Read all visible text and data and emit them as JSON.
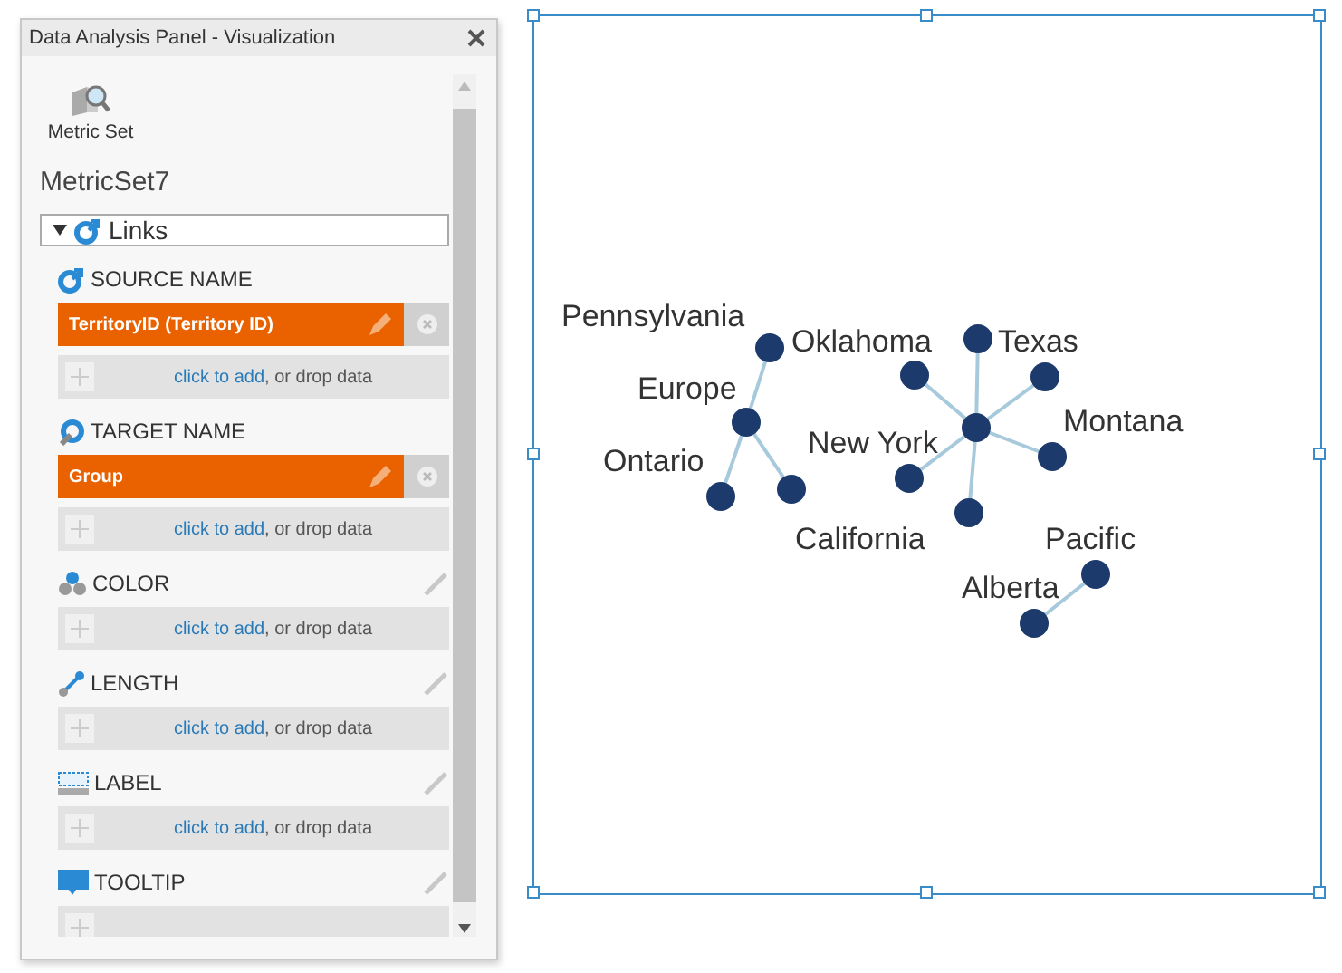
{
  "panel": {
    "title": "Data Analysis Panel - Visualization",
    "tool": {
      "label": "Metric Set"
    },
    "name": "MetricSet7",
    "group": {
      "label": "Links",
      "expanded": true
    },
    "sections": [
      {
        "kind": "source",
        "label": "SOURCE NAME",
        "items": [
          "TerritoryID (Territory ID)"
        ],
        "add_link": "click to add",
        "add_rest": ", or drop data"
      },
      {
        "kind": "target",
        "label": "TARGET NAME",
        "items": [
          "Group"
        ],
        "add_link": "click to add",
        "add_rest": ", or drop data"
      },
      {
        "kind": "color",
        "label": "COLOR",
        "add_link": "click to add",
        "add_rest": ", or drop data"
      },
      {
        "kind": "length",
        "label": "LENGTH",
        "add_link": "click to add",
        "add_rest": ", or drop data"
      },
      {
        "kind": "label",
        "label": "LABEL",
        "add_link": "click to add",
        "add_rest": ", or drop data"
      },
      {
        "kind": "tooltip",
        "label": "TOOLTIP"
      }
    ]
  },
  "network": {
    "nodes": [
      {
        "kind": "point",
        "label": "Europe",
        "children": [
          {
            "kind": "point",
            "label": "Pennsylvania"
          },
          {
            "kind": "point",
            "label": "Ontario"
          },
          {
            "kind": "point"
          }
        ]
      },
      {
        "kind": "point",
        "label": "New York",
        "children": [
          {
            "kind": "point",
            "label": "Oklahoma"
          },
          {
            "kind": "point",
            "label": "Texas"
          },
          {
            "kind": "point",
            "label": "Montana"
          },
          {
            "kind": "point",
            "label": "California"
          },
          {
            "kind": "point"
          },
          {
            "kind": "point"
          }
        ]
      },
      {
        "kind": "point",
        "label": "Pacific",
        "children": [
          {
            "kind": "point",
            "label": "Alberta"
          }
        ]
      }
    ]
  }
}
